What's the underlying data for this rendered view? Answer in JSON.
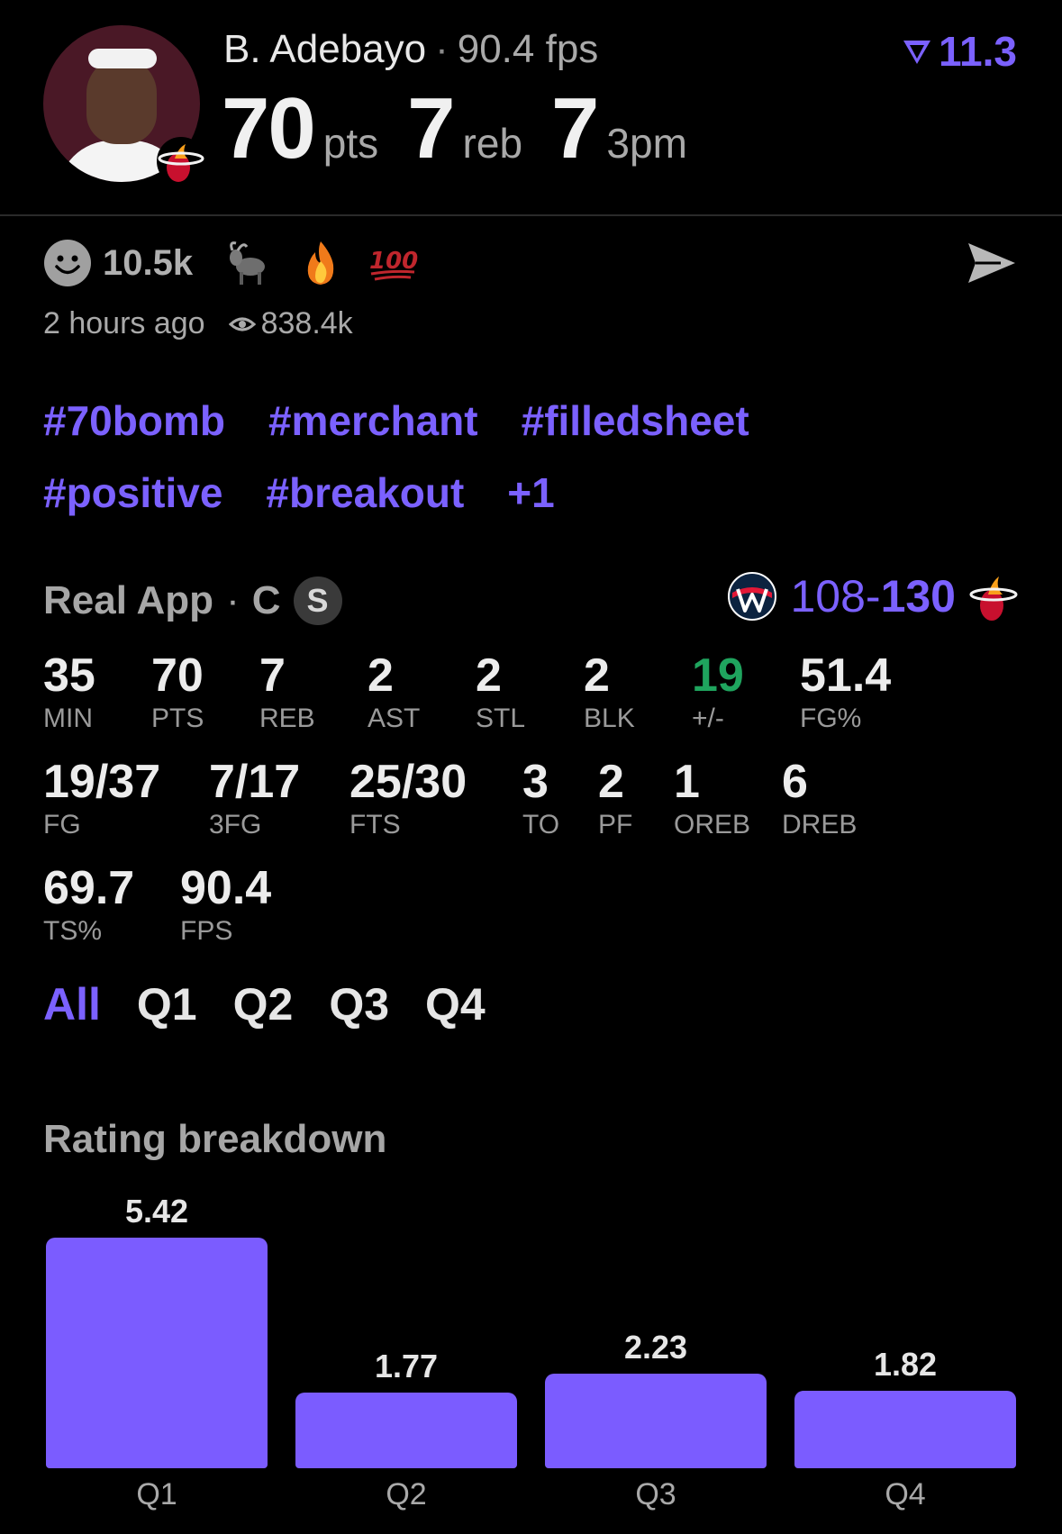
{
  "player": {
    "name": "B. Adebayo",
    "separator": "·",
    "fps_text": "90.4 fps",
    "headline": [
      {
        "value": "70",
        "unit": "pts"
      },
      {
        "value": "7",
        "unit": "reb"
      },
      {
        "value": "7",
        "unit": "3pm"
      }
    ],
    "rating": "11.3"
  },
  "social": {
    "reaction_count": "10.5k",
    "emojis": [
      "goat",
      "fire",
      "hundred"
    ],
    "time_ago": "2 hours ago",
    "views": "838.4k"
  },
  "tags": {
    "row1": [
      "#70bomb",
      "#merchant",
      "#filledsheet"
    ],
    "row2": [
      "#positive",
      "#breakout",
      "+1"
    ]
  },
  "game": {
    "app": "Real App",
    "position": "C",
    "badge": "S",
    "away_score": "108",
    "dash": "-",
    "home_score": "130"
  },
  "stats": {
    "row1": [
      {
        "v": "35",
        "l": "MIN"
      },
      {
        "v": "70",
        "l": "PTS"
      },
      {
        "v": "7",
        "l": "REB"
      },
      {
        "v": "2",
        "l": "AST"
      },
      {
        "v": "2",
        "l": "STL"
      },
      {
        "v": "2",
        "l": "BLK"
      },
      {
        "v": "19",
        "l": "+/-"
      },
      {
        "v": "51.4",
        "l": "FG%"
      }
    ],
    "row2": [
      {
        "v": "19/37",
        "l": "FG"
      },
      {
        "v": "7/17",
        "l": "3FG"
      },
      {
        "v": "25/30",
        "l": "FTS"
      },
      {
        "v": "3",
        "l": "TO"
      },
      {
        "v": "2",
        "l": "PF"
      },
      {
        "v": "1",
        "l": "OREB"
      },
      {
        "v": "6",
        "l": "DREB"
      }
    ],
    "row3": [
      {
        "v": "69.7",
        "l": "TS%"
      },
      {
        "v": "90.4",
        "l": "FPS"
      }
    ]
  },
  "periods": [
    "All",
    "Q1",
    "Q2",
    "Q3",
    "Q4"
  ],
  "breakdown_title": "Rating breakdown",
  "chart_data": {
    "type": "bar",
    "categories": [
      "Q1",
      "Q2",
      "Q3",
      "Q4"
    ],
    "values": [
      5.42,
      1.77,
      2.23,
      1.82
    ],
    "title": "Rating breakdown",
    "ylim": [
      0,
      5.42
    ]
  },
  "colors": {
    "accent": "#7b61ff",
    "positive": "#1fa45e",
    "background": "#000000"
  }
}
